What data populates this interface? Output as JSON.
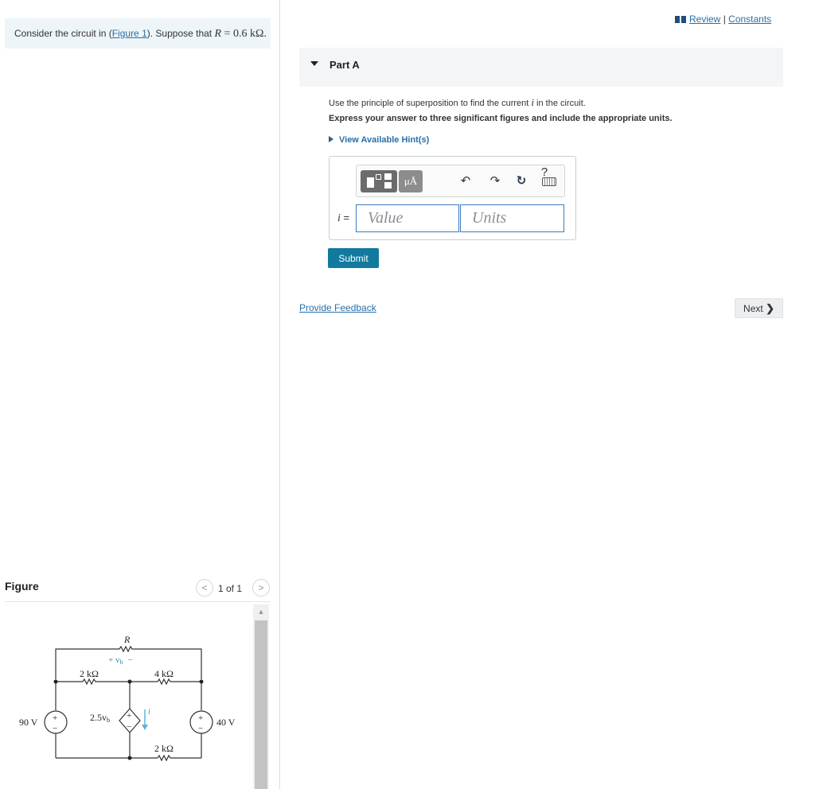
{
  "problem": {
    "prefix": "Consider the circuit in (",
    "figure_link": "Figure 1",
    "middle": "). Suppose that ",
    "var": "R",
    "eq": " = 0.6 kΩ."
  },
  "figure": {
    "title": "Figure",
    "pager": "1 of 1",
    "prev_glyph": "<",
    "next_glyph": ">",
    "scroll_up_glyph": "▲",
    "circuit_labels": {
      "r": "R",
      "vb": "+ v",
      "vb_sub": "b",
      "vb_minus": "−",
      "r1": "2 kΩ",
      "r2": "4 kΩ",
      "r3": "2 kΩ",
      "v1": "90 V",
      "v2": "40 V",
      "dep": "2.5v",
      "dep_sub": "b",
      "i": "i",
      "plus": "+",
      "minus": "−"
    }
  },
  "header": {
    "review": "Review",
    "separator": " | ",
    "constants": "Constants"
  },
  "part": {
    "title": "Part A",
    "instruction_pre": "Use the principle of superposition to find the current ",
    "instruction_var": "i",
    "instruction_post": " in the circuit.",
    "express": "Express your answer to three significant figures and include the appropriate units.",
    "hints": "View Available Hint(s)"
  },
  "answer": {
    "var": "i",
    "eq": " =",
    "value_placeholder": "Value",
    "units_placeholder": "Units",
    "units_btn": "μÅ",
    "undo": "↶",
    "redo": "↷",
    "reset": "↻",
    "help": "?",
    "submit": "Submit"
  },
  "footer": {
    "feedback": "Provide Feedback",
    "next": "Next",
    "next_chev": "❯"
  },
  "colors": {
    "link": "#2a6fa8",
    "submit": "#117a9e",
    "input_border": "#3a7bbf",
    "problem_bg": "#eef5f8"
  }
}
